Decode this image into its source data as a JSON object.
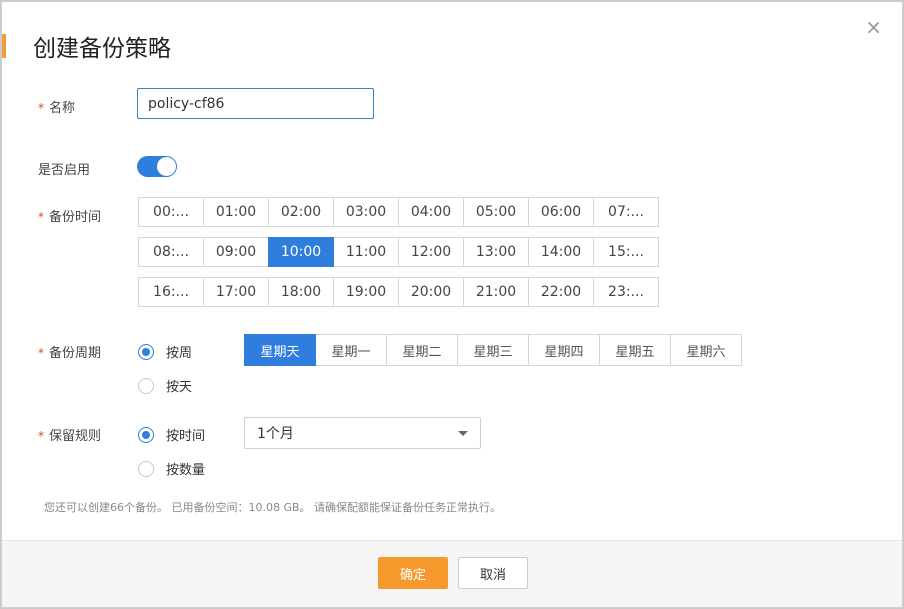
{
  "dialog": {
    "title": "创建备份策略",
    "close_glyph": "×",
    "close_icon": "close-icon"
  },
  "name": {
    "label": "名称",
    "required": "*",
    "value": "policy-cf86"
  },
  "enabled": {
    "label": "是否启用",
    "on": true
  },
  "backup_time": {
    "label": "备份时间",
    "required": "*",
    "rows": [
      [
        "00:...",
        "01:00",
        "02:00",
        "03:00",
        "04:00",
        "05:00",
        "06:00",
        "07:..."
      ],
      [
        "08:...",
        "09:00",
        "10:00",
        "11:00",
        "12:00",
        "13:00",
        "14:00",
        "15:..."
      ],
      [
        "16:...",
        "17:00",
        "18:00",
        "19:00",
        "20:00",
        "21:00",
        "22:00",
        "23:..."
      ]
    ],
    "selected": "10:00"
  },
  "backup_cycle": {
    "label": "备份周期",
    "required": "*",
    "options": [
      {
        "label": "按周",
        "checked": true
      },
      {
        "label": "按天",
        "checked": false
      }
    ],
    "weekdays": [
      "星期天",
      "星期一",
      "星期二",
      "星期三",
      "星期四",
      "星期五",
      "星期六"
    ],
    "selected_weekday": "星期天"
  },
  "retention": {
    "label": "保留规则",
    "required": "*",
    "options": [
      {
        "label": "按时间",
        "checked": true
      },
      {
        "label": "按数量",
        "checked": false
      }
    ],
    "select_value": "1个月",
    "select_icon": "chevron-down-icon"
  },
  "note": "您还可以创建66个备份。 已用备份空间：10.08 GB。 请确保配额能保证备份任务正常执行。",
  "footer": {
    "ok_label": "确定",
    "cancel_label": "取消"
  },
  "colors": {
    "accent_blue": "#2f7ddc",
    "accent_orange": "#f5992d",
    "required_red": "#e1472f"
  }
}
